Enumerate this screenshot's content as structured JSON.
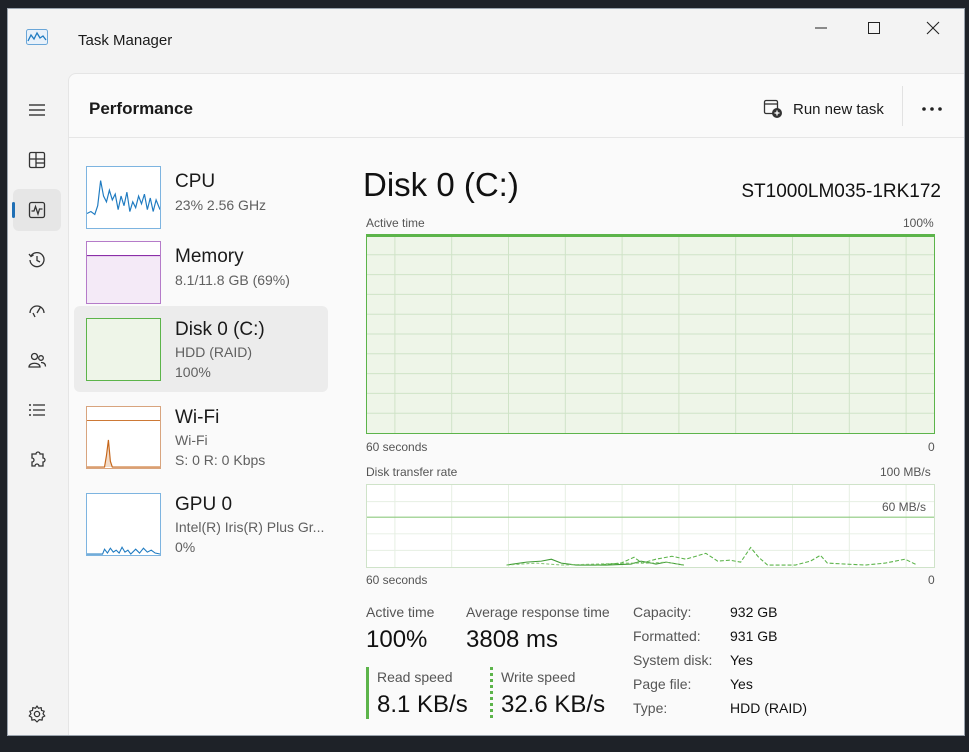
{
  "window": {
    "title": "Task Manager"
  },
  "header": {
    "page_title": "Performance",
    "run_new_task_label": "Run new task"
  },
  "devices": [
    {
      "name": "CPU",
      "sub1": "23%  2.56 GHz",
      "sub2": ""
    },
    {
      "name": "Memory",
      "sub1": "8.1/11.8 GB (69%)",
      "sub2": ""
    },
    {
      "name": "Disk 0 (C:)",
      "sub1": "HDD (RAID)",
      "sub2": "100%"
    },
    {
      "name": "Wi-Fi",
      "sub1": "Wi-Fi",
      "sub2": "S: 0 R: 0 Kbps"
    },
    {
      "name": "GPU 0",
      "sub1": "Intel(R) Iris(R) Plus Gr...",
      "sub2": "0%"
    }
  ],
  "main": {
    "title": "Disk 0 (C:)",
    "model": "ST1000LM035-1RK172",
    "active_chart": {
      "label": "Active time",
      "max": "100%",
      "time_label": "60 seconds",
      "min": "0"
    },
    "transfer_chart": {
      "label": "Disk transfer rate",
      "max": "100 MB/s",
      "mid_label": "60 MB/s",
      "time_label": "60 seconds",
      "min": "0"
    },
    "stats": {
      "active_time_label": "Active time",
      "active_time_value": "100%",
      "avg_response_label": "Average response time",
      "avg_response_value": "3808 ms",
      "read_label": "Read speed",
      "read_value": "8.1 KB/s",
      "write_label": "Write speed",
      "write_value": "32.6 KB/s"
    },
    "info": [
      {
        "label": "Capacity:",
        "value": "932 GB"
      },
      {
        "label": "Formatted:",
        "value": "931 GB"
      },
      {
        "label": "System disk:",
        "value": "Yes"
      },
      {
        "label": "Page file:",
        "value": "Yes"
      },
      {
        "label": "Type:",
        "value": "HDD (RAID)"
      }
    ]
  },
  "colors": {
    "disk_accent": "#5cb44a",
    "cpu_accent": "#1f7bc1",
    "memory_accent": "#8b2fa8",
    "wifi_accent": "#c6661a",
    "nav_indicator": "#1f6fb5"
  },
  "icons": [
    "hamburger-icon",
    "processes-icon",
    "performance-icon",
    "app-history-icon",
    "startup-icon",
    "users-icon",
    "details-icon",
    "services-icon",
    "settings-icon"
  ]
}
